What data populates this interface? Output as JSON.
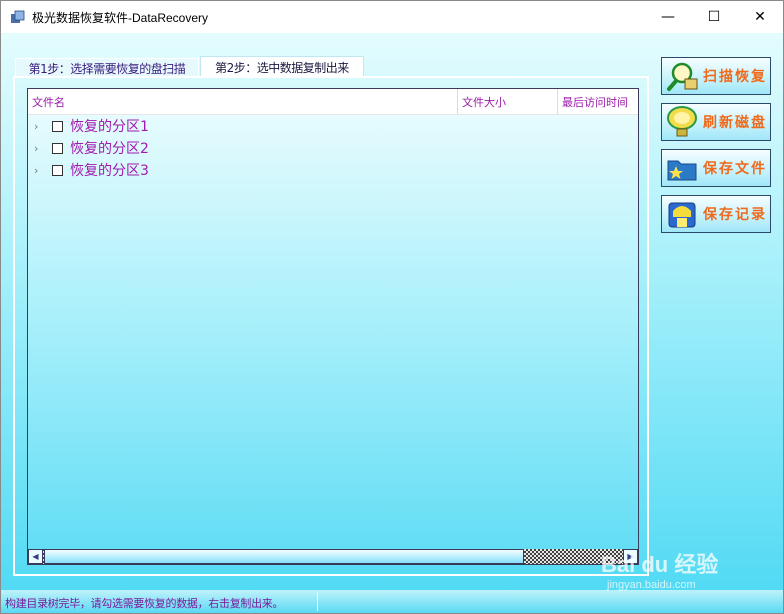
{
  "window": {
    "title": "极光数据恢复软件-DataRecovery",
    "controls": {
      "minimize": "—",
      "maximize": "☐",
      "close": "✕"
    }
  },
  "tabs": [
    {
      "label": "第1步：选择需要恢复的盘扫描",
      "selected": false
    },
    {
      "label": "第2步：选中数据复制出来",
      "selected": true
    }
  ],
  "tree": {
    "columns": [
      "文件名",
      "文件大小",
      "最后访问时间"
    ],
    "nodes": [
      {
        "label": "恢复的分区1",
        "checked": false,
        "expanded": false
      },
      {
        "label": "恢复的分区2",
        "checked": false,
        "expanded": false
      },
      {
        "label": "恢复的分区3",
        "checked": false,
        "expanded": false
      }
    ],
    "expander_glyph": "›",
    "scroll_left_glyph": "◀",
    "scroll_right_glyph": "▶"
  },
  "actions": [
    {
      "label": "扫描恢复",
      "icon": "magnifier-scan-icon"
    },
    {
      "label": "刷新磁盘",
      "icon": "refresh-disk-icon"
    },
    {
      "label": "保存文件",
      "icon": "save-file-icon"
    },
    {
      "label": "保存记录",
      "icon": "save-record-icon"
    }
  ],
  "status": {
    "text": "构建目录树完毕，请勾选需要恢复的数据，右击复制出来。"
  },
  "watermark": {
    "brand": "Bai du 经验",
    "url": "jingyan.baidu.com"
  },
  "colors": {
    "accent_label": "#ef6a1c",
    "tree_text": "#a01ab0",
    "status_text": "#7a1a9a",
    "client_gradient_top": "#e4fcfd",
    "client_gradient_bottom": "#52daf4"
  }
}
